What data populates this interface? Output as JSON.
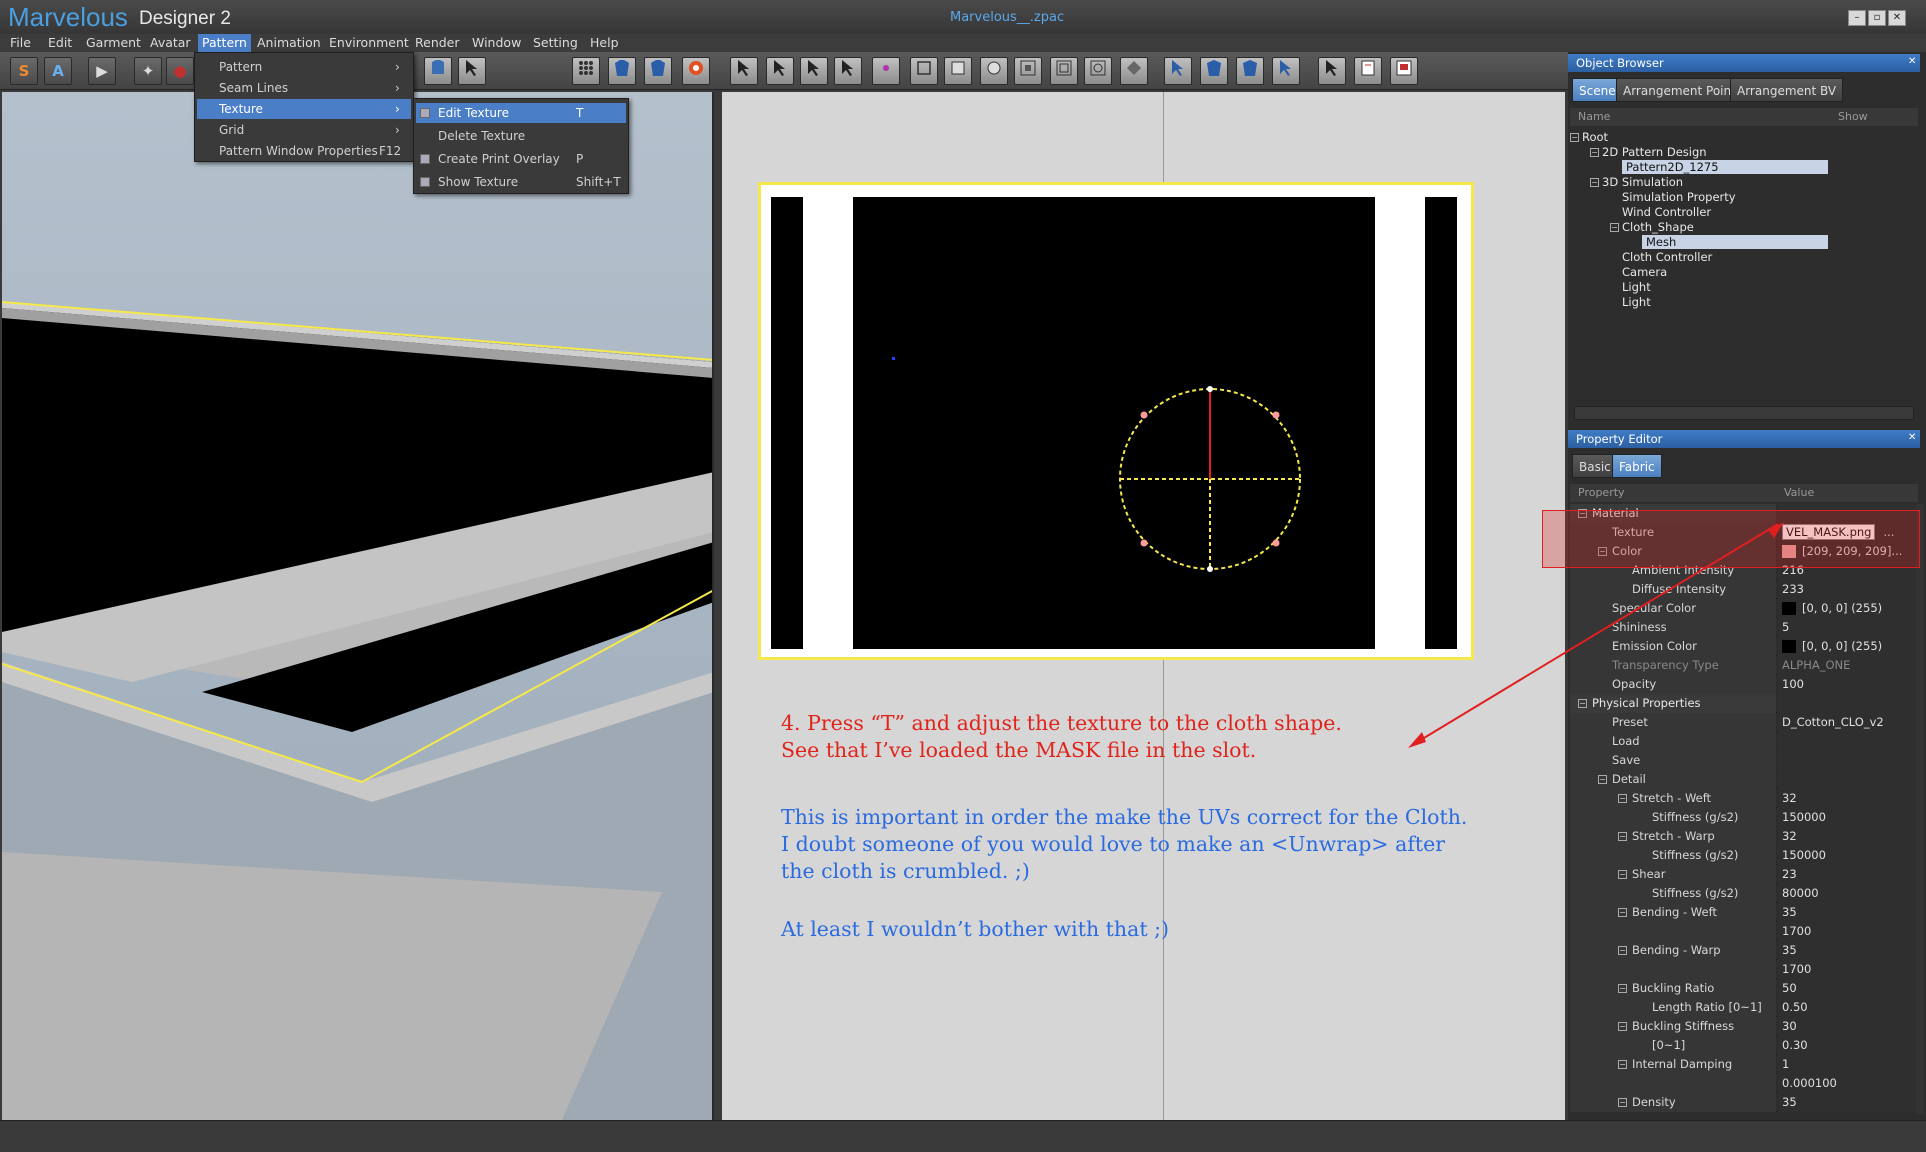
{
  "app": {
    "logo_main": "Marvelous",
    "logo_sub": "Designer 2",
    "window_title": "Marvelous__.zpac",
    "window_buttons": [
      "–",
      "▫",
      "✕"
    ]
  },
  "menubar": [
    "File",
    "Edit",
    "Garment",
    "Avatar",
    "Pattern",
    "Animation",
    "Environment",
    "Render",
    "Window",
    "Setting",
    "Help"
  ],
  "pattern_menu": {
    "items": [
      {
        "label": "Pattern",
        "arrow": "›"
      },
      {
        "label": "Seam Lines",
        "arrow": "›"
      },
      {
        "label": "Texture",
        "arrow": "›"
      },
      {
        "label": "Grid",
        "arrow": "›"
      },
      {
        "label": "Pattern Window Properties",
        "shortcut": "F12"
      }
    ]
  },
  "texture_submenu": {
    "items": [
      {
        "label": "Edit Texture",
        "shortcut": "T"
      },
      {
        "label": "Delete Texture",
        "shortcut": ""
      },
      {
        "label": "Create Print Overlay",
        "shortcut": "P"
      },
      {
        "label": "Show Texture",
        "shortcut": "Shift+T"
      }
    ]
  },
  "toolbar": {
    "left_buttons": [
      "S",
      "A",
      "▶",
      "✦",
      "●"
    ],
    "left_icons": [
      "simulate-icon",
      "animate-icon",
      "play-icon",
      "avatar-pose-icon",
      "record-icon"
    ]
  },
  "annotations": {
    "red_text": "4. Press “T” and adjust the texture to the cloth shape.\nSee that I’ve loaded the MASK file in the slot.",
    "blue_text_1": "This is important in order the make the UVs correct for the Cloth.\nI doubt someone of you would love to make an <Unwrap> after\nthe cloth is crumbled. ;)",
    "blue_text_2": "At least I wouldn’t bother with that ;)"
  },
  "object_browser": {
    "title": "Object Browser",
    "tabs": [
      "Scene",
      "Arrangement Point",
      "Arrangement BV"
    ],
    "columns": [
      "Name",
      "Show"
    ],
    "tree": [
      {
        "label": "Root",
        "level": 0,
        "expander": "−"
      },
      {
        "label": "2D Pattern Design",
        "level": 1,
        "expander": "−"
      },
      {
        "label": "Pattern2D_1275",
        "level": 2,
        "selected": true
      },
      {
        "label": "3D Simulation",
        "level": 1,
        "expander": "−"
      },
      {
        "label": "Simulation Property",
        "level": 2
      },
      {
        "label": "Wind Controller",
        "level": 2
      },
      {
        "label": "Cloth_Shape",
        "level": 2,
        "expander": "−"
      },
      {
        "label": "Mesh",
        "level": 3,
        "selected": true
      },
      {
        "label": "Cloth Controller",
        "level": 2
      },
      {
        "label": "Camera",
        "level": 2
      },
      {
        "label": "Light",
        "level": 2
      },
      {
        "label": "Light",
        "level": 2
      }
    ]
  },
  "property_editor": {
    "title": "Property Editor",
    "tabs": [
      "Basic",
      "Fabric"
    ],
    "columns": [
      "Property",
      "Value"
    ],
    "rows": [
      {
        "name": "Material",
        "value": "",
        "indent": 0,
        "expander": "−",
        "group": true
      },
      {
        "name": "Texture",
        "value": "VEL_MASK.png",
        "indent": 1,
        "extra": "..."
      },
      {
        "name": "Color",
        "value": "[209, 209, 209]...",
        "indent": 1,
        "expander": "−",
        "swatch": "#e8a8a8"
      },
      {
        "name": "Ambient Intensity",
        "value": "216",
        "indent": 2
      },
      {
        "name": "Diffuse Intensity",
        "value": "233",
        "indent": 2
      },
      {
        "name": "Specular Color",
        "value": "[0, 0, 0] (255)",
        "indent": 1,
        "swatch": "#000000"
      },
      {
        "name": "Shininess",
        "value": "5",
        "indent": 1
      },
      {
        "name": "Emission Color",
        "value": "[0, 0, 0] (255)",
        "indent": 1,
        "swatch": "#000000"
      },
      {
        "name": "Transparency Type",
        "value": "ALPHA_ONE",
        "indent": 1,
        "dim": true
      },
      {
        "name": "Opacity",
        "value": "100",
        "indent": 1
      },
      {
        "name": "Physical Properties",
        "value": "",
        "indent": 0,
        "expander": "−",
        "group": true
      },
      {
        "name": "Preset",
        "value": "D_Cotton_CLO_v2",
        "indent": 1
      },
      {
        "name": "Load",
        "value": "",
        "indent": 1
      },
      {
        "name": "Save",
        "value": "",
        "indent": 1
      },
      {
        "name": "Detail",
        "value": "",
        "indent": 1,
        "expander": "−"
      },
      {
        "name": "Stretch - Weft",
        "value": "32",
        "indent": 2,
        "expander": "−"
      },
      {
        "name": "Stiffness (g/s2)",
        "value": "150000",
        "indent": 3
      },
      {
        "name": "Stretch - Warp",
        "value": "32",
        "indent": 2,
        "expander": "−"
      },
      {
        "name": "Stiffness (g/s2)",
        "value": "150000",
        "indent": 3
      },
      {
        "name": "Shear",
        "value": "23",
        "indent": 2,
        "expander": "−"
      },
      {
        "name": "Stiffness (g/s2)",
        "value": "80000",
        "indent": 3
      },
      {
        "name": "Bending - Weft",
        "value": "35",
        "indent": 2,
        "expander": "−"
      },
      {
        "name": "",
        "value": "1700",
        "indent": 3
      },
      {
        "name": "Bending - Warp",
        "value": "35",
        "indent": 2,
        "expander": "−"
      },
      {
        "name": "",
        "value": "1700",
        "indent": 3
      },
      {
        "name": "Buckling Ratio",
        "value": "50",
        "indent": 2,
        "expander": "−"
      },
      {
        "name": "Length Ratio [0~1]",
        "value": "0.50",
        "indent": 3
      },
      {
        "name": "Buckling Stiffness",
        "value": "30",
        "indent": 2,
        "expander": "−"
      },
      {
        "name": "[0~1]",
        "value": "0.30",
        "indent": 3
      },
      {
        "name": "Internal Damping",
        "value": "1",
        "indent": 2,
        "expander": "−"
      },
      {
        "name": "",
        "value": "0.000100",
        "indent": 3
      },
      {
        "name": "Density",
        "value": "35",
        "indent": 2,
        "expander": "−"
      }
    ]
  },
  "colors": {
    "accent": "#4a7fc8",
    "highlight_box": "#e02020",
    "pattern_outline": "#f4e84a",
    "circle_gizmo": "#f4e84a"
  }
}
